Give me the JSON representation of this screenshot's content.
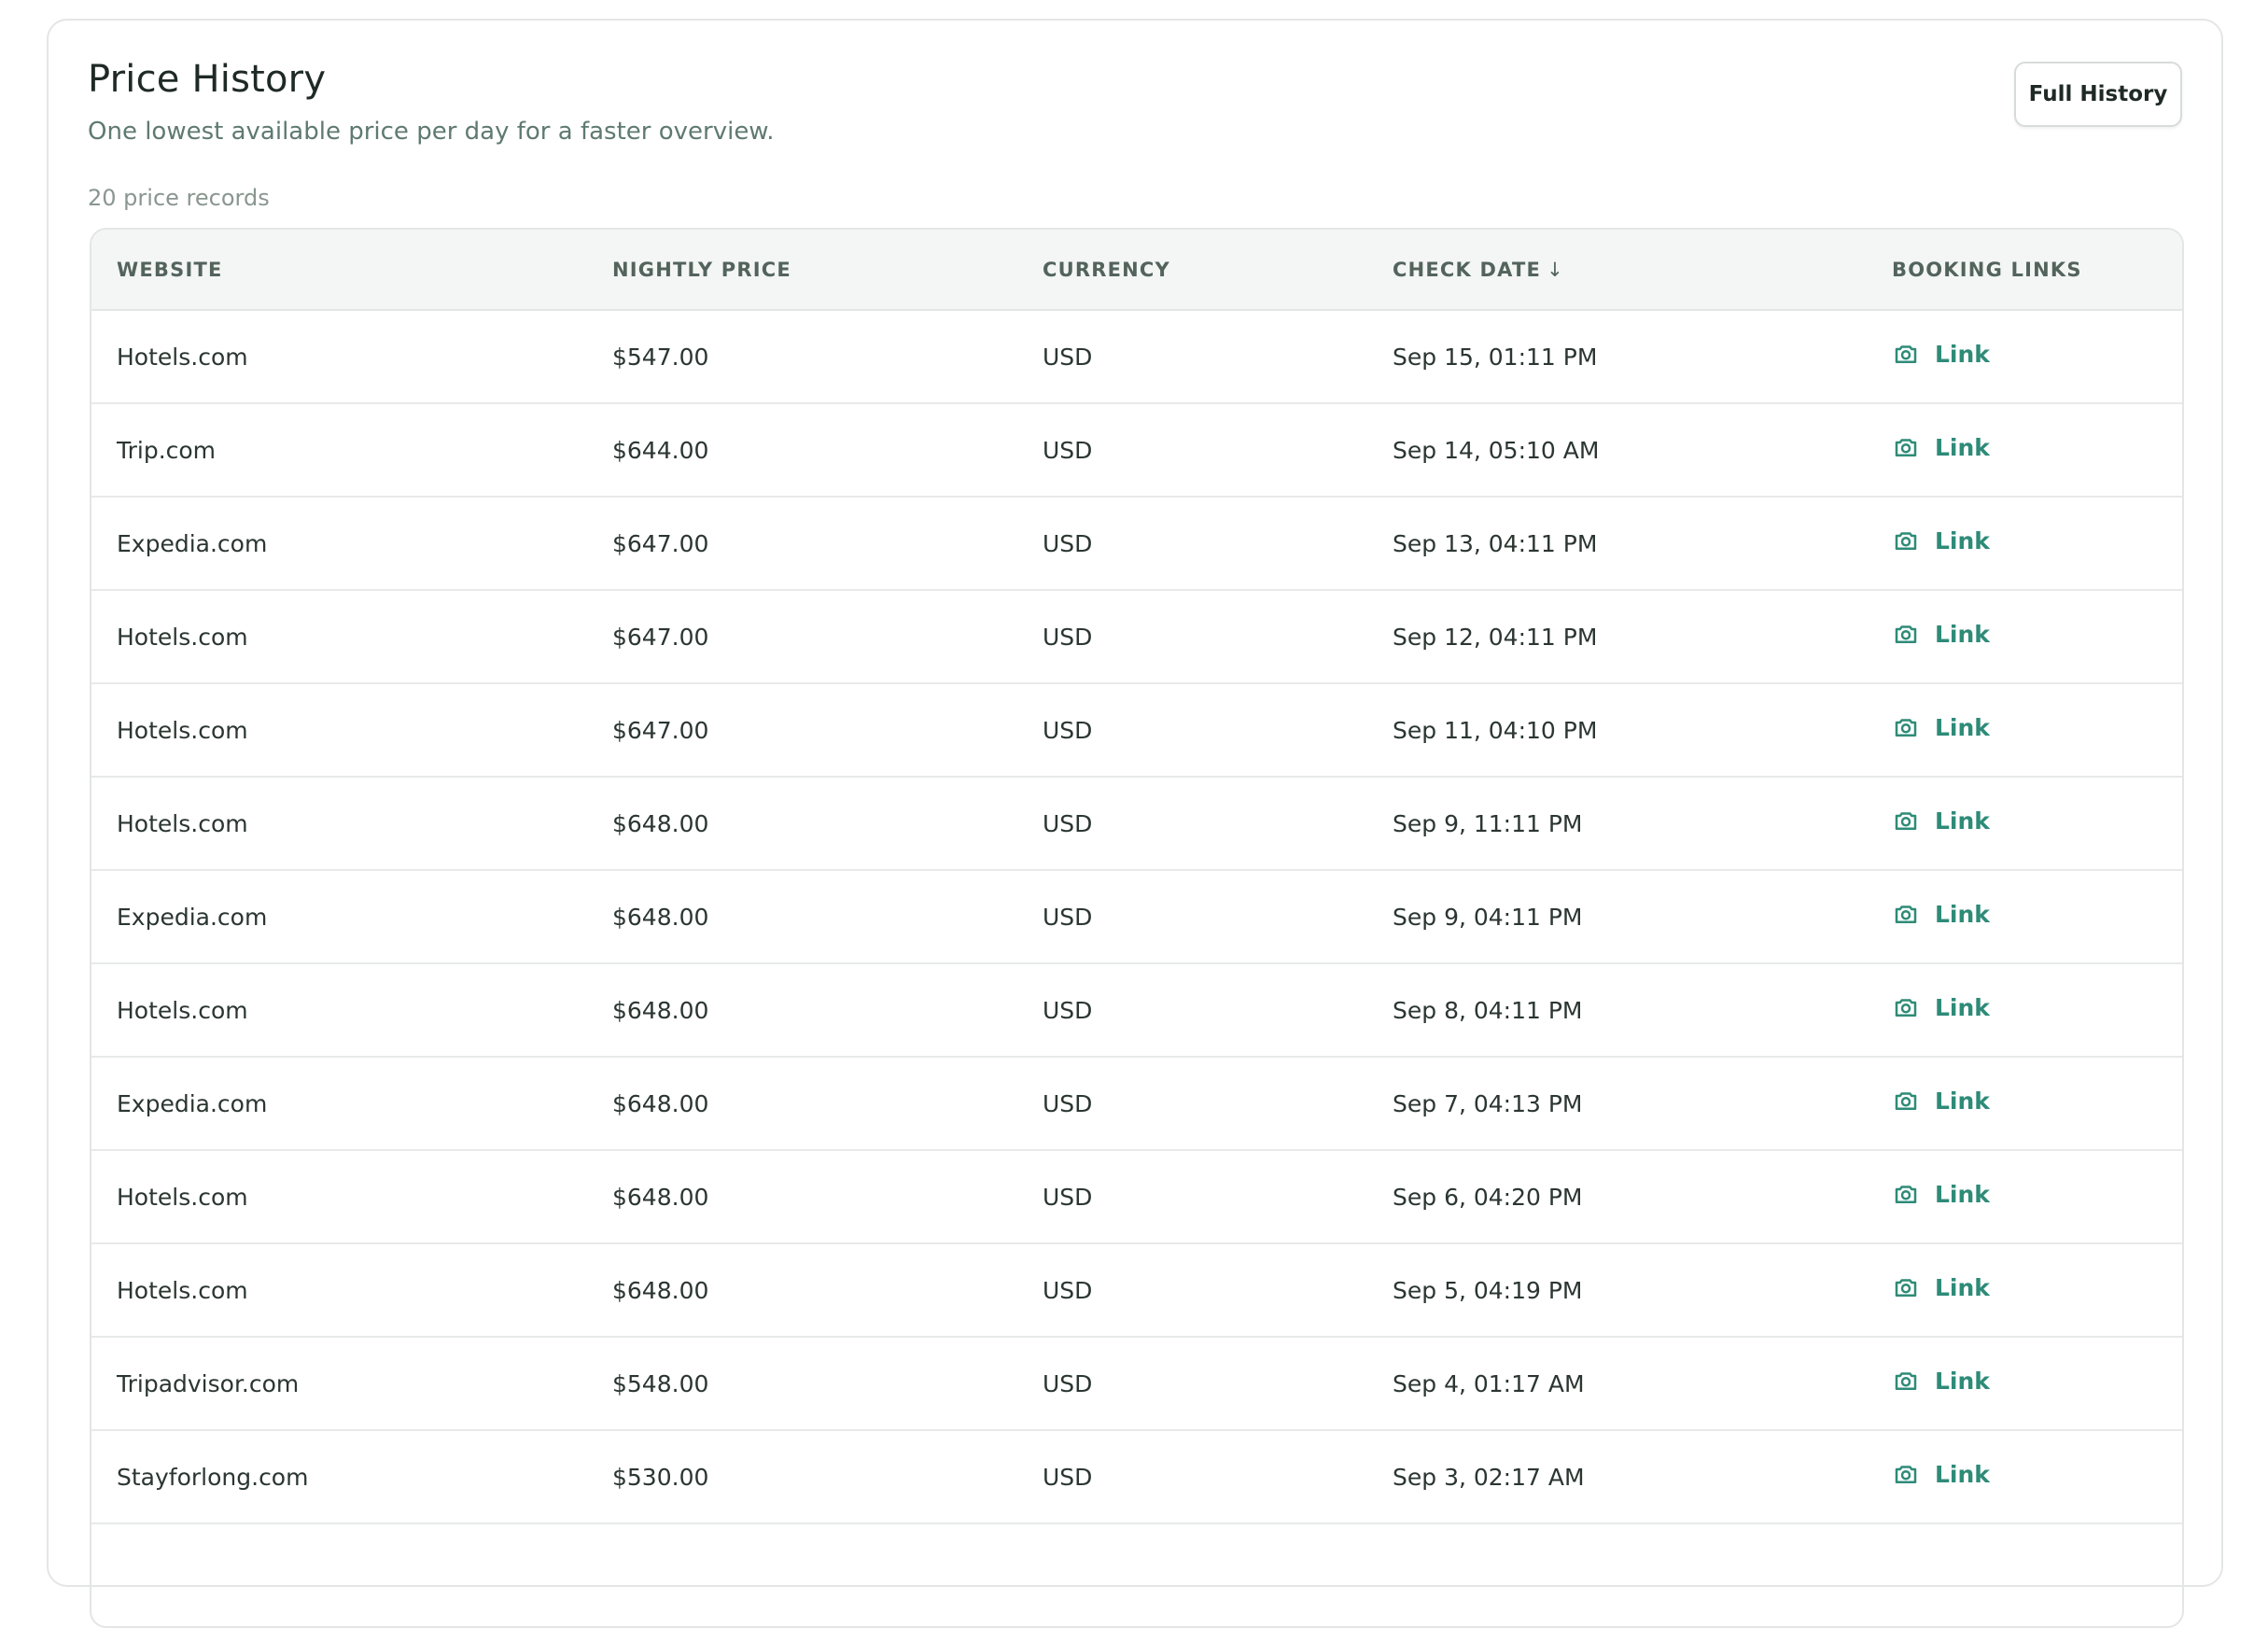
{
  "header": {
    "title": "Price History",
    "subtitle": "One lowest available price per day for a faster overview.",
    "record_count": "20 price records",
    "full_history_label": "Full History"
  },
  "table": {
    "columns": [
      "WEBSITE",
      "NIGHTLY PRICE",
      "CURRENCY",
      "CHECK DATE",
      "BOOKING LINKS"
    ],
    "sort_indicator": "↓",
    "rows": [
      {
        "website": "Hotels.com",
        "price": "$547.00",
        "currency": "USD",
        "date": "Sep 15, 01:11 PM",
        "link": "Link"
      },
      {
        "website": "Trip.com",
        "price": "$644.00",
        "currency": "USD",
        "date": "Sep 14, 05:10 AM",
        "link": "Link"
      },
      {
        "website": "Expedia.com",
        "price": "$647.00",
        "currency": "USD",
        "date": "Sep 13, 04:11 PM",
        "link": "Link"
      },
      {
        "website": "Hotels.com",
        "price": "$647.00",
        "currency": "USD",
        "date": "Sep 12, 04:11 PM",
        "link": "Link"
      },
      {
        "website": "Hotels.com",
        "price": "$647.00",
        "currency": "USD",
        "date": "Sep 11, 04:10 PM",
        "link": "Link"
      },
      {
        "website": "Hotels.com",
        "price": "$648.00",
        "currency": "USD",
        "date": "Sep 9, 11:11 PM",
        "link": "Link"
      },
      {
        "website": "Expedia.com",
        "price": "$648.00",
        "currency": "USD",
        "date": "Sep 9, 04:11 PM",
        "link": "Link"
      },
      {
        "website": "Hotels.com",
        "price": "$648.00",
        "currency": "USD",
        "date": "Sep 8, 04:11 PM",
        "link": "Link"
      },
      {
        "website": "Expedia.com",
        "price": "$648.00",
        "currency": "USD",
        "date": "Sep 7, 04:13 PM",
        "link": "Link"
      },
      {
        "website": "Hotels.com",
        "price": "$648.00",
        "currency": "USD",
        "date": "Sep 6, 04:20 PM",
        "link": "Link"
      },
      {
        "website": "Hotels.com",
        "price": "$648.00",
        "currency": "USD",
        "date": "Sep 5, 04:19 PM",
        "link": "Link"
      },
      {
        "website": "Tripadvisor.com",
        "price": "$548.00",
        "currency": "USD",
        "date": "Sep 4, 01:17 AM",
        "link": "Link"
      },
      {
        "website": "Stayforlong.com",
        "price": "$530.00",
        "currency": "USD",
        "date": "Sep 3, 02:17 AM",
        "link": "Link"
      }
    ]
  },
  "icons": {
    "link_icon": "camera-icon"
  },
  "colors": {
    "accent": "#2e8b78",
    "subtitle": "#5f7a70",
    "header_bg": "#f4f6f5"
  }
}
